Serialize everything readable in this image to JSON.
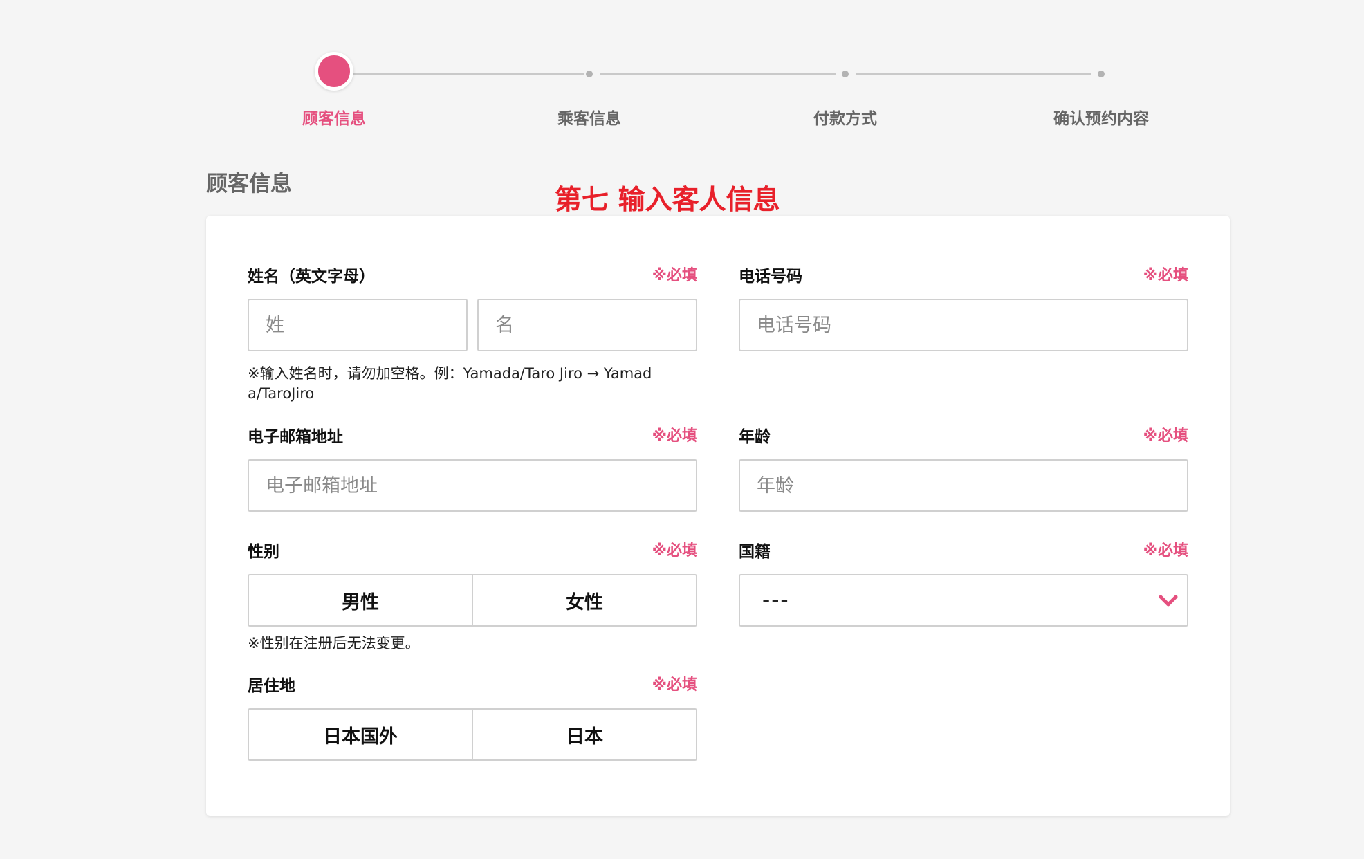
{
  "stepper": {
    "steps": [
      {
        "label": "顾客信息",
        "active": true
      },
      {
        "label": "乘客信息",
        "active": false
      },
      {
        "label": "付款方式",
        "active": false
      },
      {
        "label": "确认预约内容",
        "active": false
      }
    ]
  },
  "section_title": "顾客信息",
  "annotation": "第七 输入客人信息",
  "required_mark": "※必填",
  "form": {
    "name": {
      "label": "姓名（英文字母）",
      "last_placeholder": "姓",
      "first_placeholder": "名",
      "note_line1": "※输入姓名时，请勿加空格。例：Yamada/Taro Jiro → Yamad",
      "note_line2": "a/TaroJiro"
    },
    "phone": {
      "label": "电话号码",
      "placeholder": "电话号码"
    },
    "email": {
      "label": "电子邮箱地址",
      "placeholder": "电子邮箱地址"
    },
    "age": {
      "label": "年龄",
      "placeholder": "年龄"
    },
    "gender": {
      "label": "性别",
      "options": [
        "男性",
        "女性"
      ],
      "note": "※性别在注册后无法变更。"
    },
    "nationality": {
      "label": "国籍",
      "value": "---"
    },
    "residence": {
      "label": "居住地",
      "options": [
        "日本国外",
        "日本"
      ]
    }
  },
  "colors": {
    "accent": "#e5507f",
    "annotation": "#e8202a",
    "inactive_step": "#b3b3b3",
    "border": "#d0d0d0"
  },
  "icons": {
    "nationality_dropdown": "chevron-down-icon"
  }
}
